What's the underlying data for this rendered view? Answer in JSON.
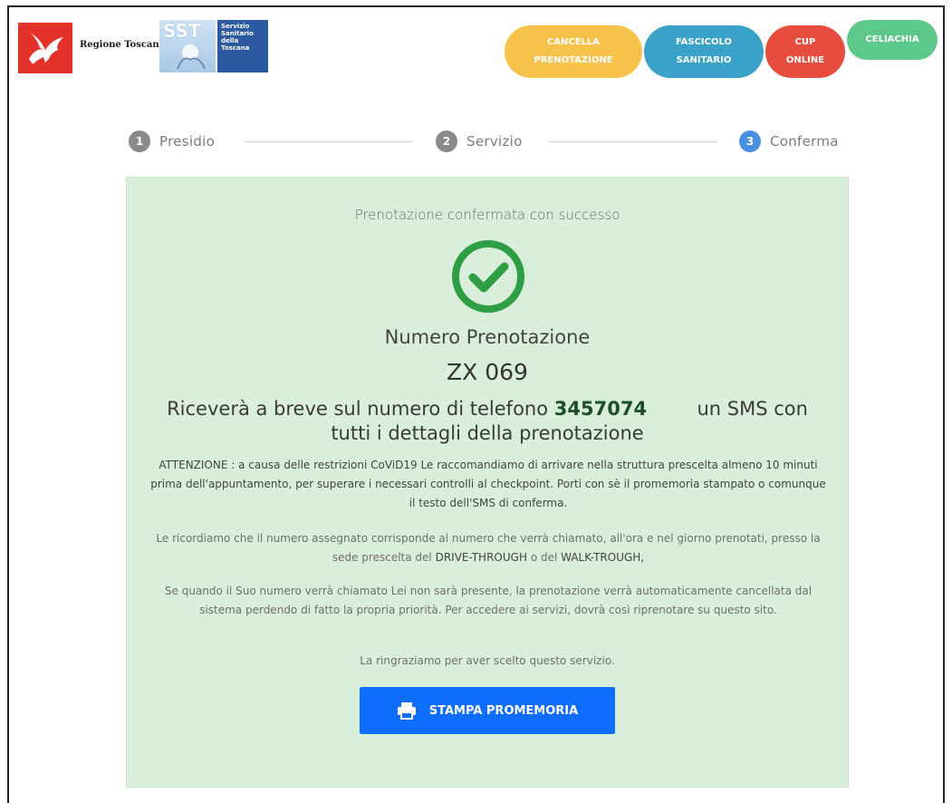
{
  "header": {
    "region_name": "Regione Toscana",
    "sst_letters": "SST",
    "sst_text": [
      "Servizio",
      "Sanitario",
      "della",
      "Toscana"
    ],
    "nav": [
      {
        "line1": "CANCELLA",
        "line2": "PRENOTAZIONE",
        "color": "#f7c24a"
      },
      {
        "line1": "FASCICOLO",
        "line2": "SANITARIO",
        "color": "#3aa2c8"
      },
      {
        "line1": "CUP",
        "line2": "ONLINE",
        "color": "#e74c3c"
      },
      {
        "line1": "CELIACHIA",
        "line2": "",
        "color": "#5cc98b"
      }
    ]
  },
  "stepper": {
    "steps": [
      {
        "num": "1",
        "label": "Presidio",
        "active": false
      },
      {
        "num": "2",
        "label": "Servizio",
        "active": false
      },
      {
        "num": "3",
        "label": "Conferma",
        "active": true
      }
    ]
  },
  "confirmation": {
    "title": "Prenotazione confermata con successo",
    "icon": "check-circle-icon",
    "number_label": "Numero Prenotazione",
    "number_value": "ZX 069",
    "sms_prefix": "Riceverà a breve sul numero di telefono",
    "phone": "3457074",
    "sms_suffix": "un SMS con",
    "sms_line2": "tutti i dettagli della prenotazione",
    "attention": "ATTENZIONE : a causa delle restrizioni CoViD19 Le raccomandiamo di arrivare nella struttura prescelta almeno 10 minuti prima dell'appuntamento, per superare i necessari controlli al checkpoint. Porti con sè il promemoria stampato o comunque il testo dell'SMS di conferma.",
    "reminder_prefix": "Le ricordiamo che il numero assegnato corrisponde al numero che verrà chiamato, all'ora e nel giorno prenotati, presso la sede prescelta del",
    "drive_through": "DRIVE-THROUGH",
    "reminder_mid": "o del",
    "walk_through": "WALK-TROUGH,",
    "warning": "Se quando il Suo numero verrà chiamato Lei non sarà presente, la prenotazione verrà automaticamente cancellata dal sistema perdendo di fatto la propria priorità. Per accedere ai servizi, dovrà così riprenotare su questo sito.",
    "thanks": "La ringraziamo per aver scelto questo servizio.",
    "print_button": "STAMPA PROMEMORIA",
    "print_icon": "print-icon",
    "success_color": "#2e9e45",
    "panel_color": "#d9eedb"
  }
}
